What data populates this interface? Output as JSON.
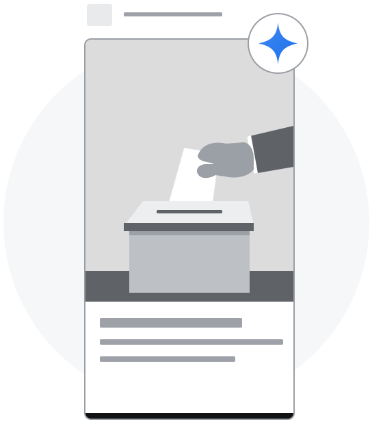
{
  "colors": {
    "background_circle": "#f6f7f8",
    "card_border": "#9a9ea4",
    "placeholder_gray": "#9ea2a8",
    "illustration_bg": "#dcdcdd",
    "dark_gray": "#5f6368",
    "ballot_box": "#bdc1c6",
    "gemini_blue_start": "#4285f4",
    "gemini_blue_end": "#1a73e8"
  },
  "icons": {
    "badge": "gemini-sparkle-icon",
    "illustration": "ballot-box-vote-icon"
  }
}
